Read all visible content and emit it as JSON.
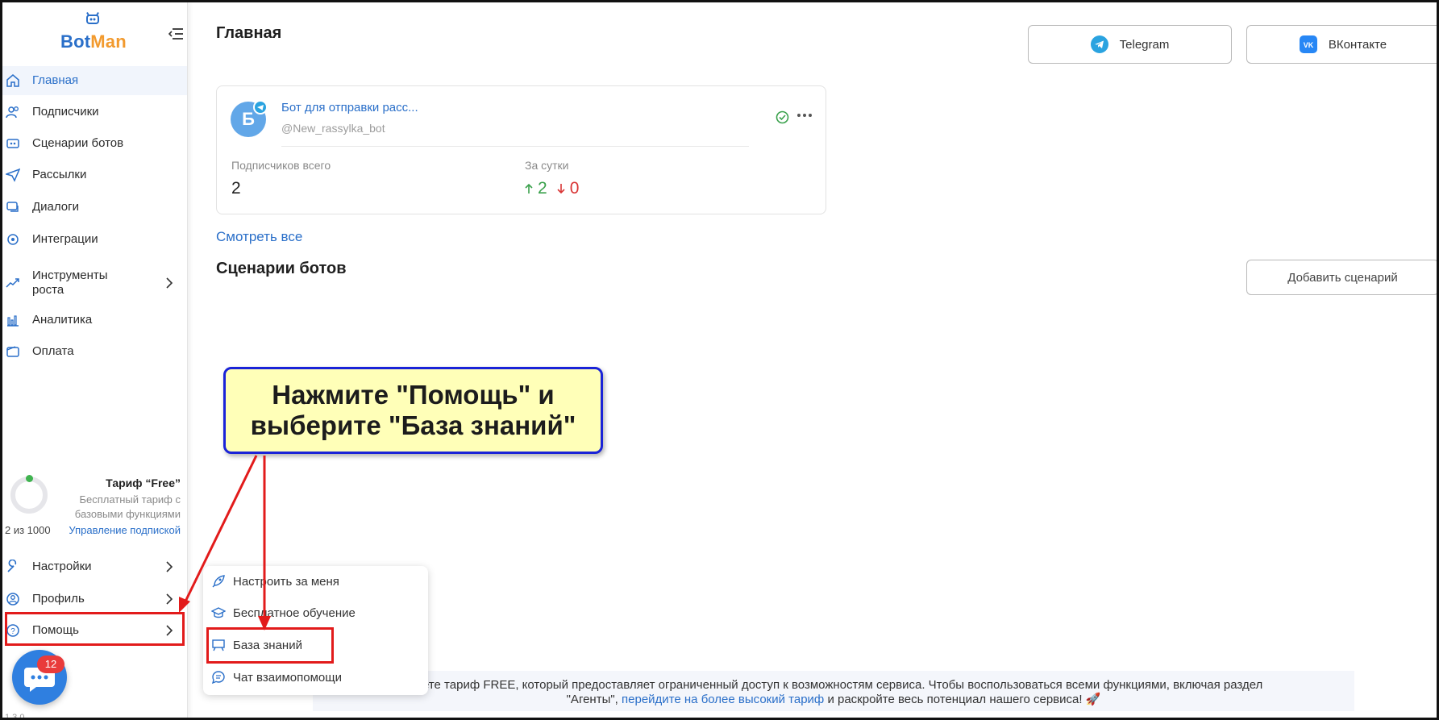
{
  "app": {
    "logo_part1": "Bot",
    "logo_part2": "Man",
    "version": "1.3.0"
  },
  "sidebar": {
    "items": [
      {
        "label": "Главная",
        "icon": "home-icon"
      },
      {
        "label": "Подписчики",
        "icon": "users-icon"
      },
      {
        "label": "Сценарии ботов",
        "icon": "scenario-icon"
      },
      {
        "label": "Рассылки",
        "icon": "send-icon"
      },
      {
        "label": "Диалоги",
        "icon": "chat-icon"
      },
      {
        "label": "Интеграции",
        "icon": "integrations-icon"
      },
      {
        "label": "Инструменты роста",
        "icon": "growth-icon"
      },
      {
        "label": "Аналитика",
        "icon": "analytics-icon"
      },
      {
        "label": "Оплата",
        "icon": "wallet-icon"
      }
    ],
    "bottom_items": [
      {
        "label": "Настройки",
        "icon": "wrench-icon"
      },
      {
        "label": "Профиль",
        "icon": "profile-icon"
      },
      {
        "label": "Помощь",
        "icon": "help-icon"
      }
    ],
    "tariff": {
      "title": "Тариф “Free”",
      "description": "Бесплатный тариф с базовыми функциями",
      "usage": "2 из 1000",
      "usage_fraction": 0.002,
      "manage": "Управление подпиской"
    },
    "chat_badge": "12"
  },
  "header": {
    "title": "Главная",
    "platforms": [
      {
        "label": "Telegram",
        "icon": "telegram-icon",
        "color": "#2aa3e0"
      },
      {
        "label": "ВКонтакте",
        "icon": "vk-icon",
        "color": "#2787f5"
      }
    ]
  },
  "bot_card": {
    "avatar_letter": "Б",
    "name": "Бот для отправки расс...",
    "handle": "@New_rassylka_bot",
    "subscribers_label": "Подписчиков всего",
    "subscribers_value": "2",
    "daily_label": "За сутки",
    "daily_up": "2",
    "daily_down": "0"
  },
  "main": {
    "see_all": "Смотреть все",
    "scenarios_title": "Сценарии ботов",
    "add_scenario": "Добавить сценарий"
  },
  "help_menu": {
    "items": [
      {
        "label": "Настроить за меня",
        "icon": "rocket-icon"
      },
      {
        "label": "Бесплатное обучение",
        "icon": "graduation-icon"
      },
      {
        "label": "База знаний",
        "icon": "board-icon"
      },
      {
        "label": "Чат взаимопомощи",
        "icon": "chat-bubble-icon"
      }
    ]
  },
  "notice": {
    "text1": "…уете тариф FREE, который предоставляет ограниченный доступ к возможностям сервиса. Чтобы воспользоваться всеми функциями, включая раздел",
    "text2": "\"Агенты\",",
    "link": "перейдите на более высокий тариф",
    "text3": "и раскройте весь потенциал нашего сервиса! 🚀"
  },
  "callout": {
    "line1": "Нажмите \"Помощь\" и",
    "line2": "выберите \"База знаний\""
  },
  "colors": {
    "accent": "#2a6fc9",
    "brand_orange": "#f29a2e",
    "highlight_red": "#e21b1b",
    "callout_border": "#1a23d8",
    "callout_bg": "#ffffb8"
  }
}
